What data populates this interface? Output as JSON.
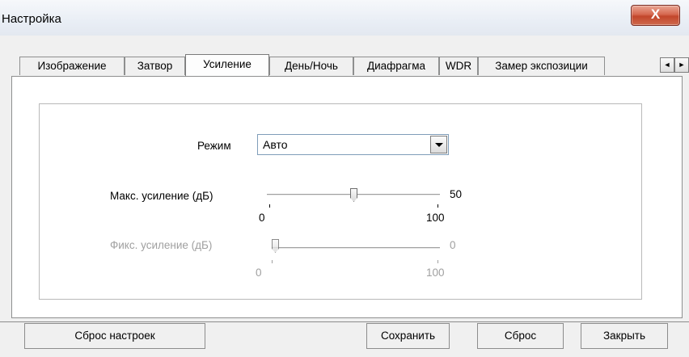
{
  "window": {
    "title": "Настройка",
    "close_glyph": "X"
  },
  "tabs": [
    {
      "label": "Изображение"
    },
    {
      "label": "Затвор"
    },
    {
      "label": "Усиление"
    },
    {
      "label": "День/Ночь"
    },
    {
      "label": "Диафрагма"
    },
    {
      "label": "WDR"
    },
    {
      "label": "Замер экспозиции"
    }
  ],
  "active_tab": "Усиление",
  "tab_scroll": {
    "left": "◄",
    "right": "►"
  },
  "mode": {
    "label": "Режим",
    "value": "Авто"
  },
  "max_gain": {
    "label": "Макс. усиление (дБ)",
    "value": "50",
    "min": "0",
    "max": "100",
    "level": 0.5
  },
  "fixed_gain": {
    "label": "Фикс. усиление (дБ)",
    "value": "0",
    "min": "0",
    "max": "100",
    "level": 0,
    "disabled": true
  },
  "buttons": {
    "reset_settings": "Сброс настроек",
    "save": "Сохранить",
    "reset": "Сброс",
    "close": "Закрыть"
  }
}
